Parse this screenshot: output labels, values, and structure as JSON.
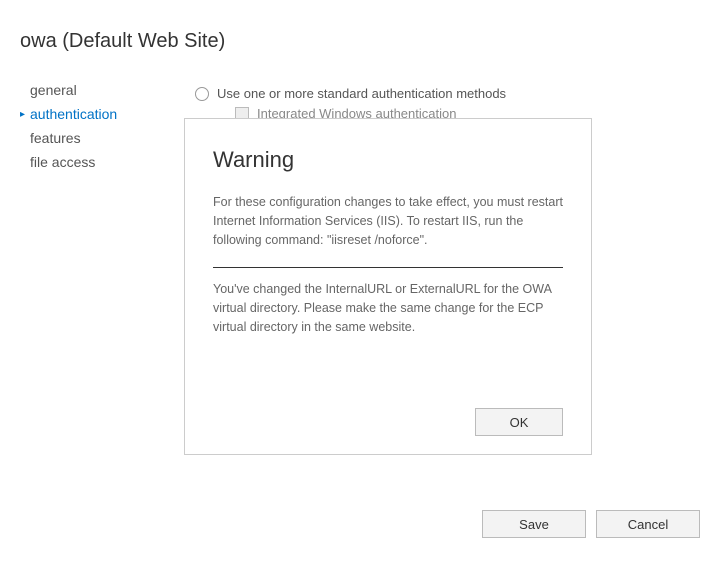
{
  "title": "owa (Default Web Site)",
  "sidebar": {
    "items": [
      {
        "label": "general"
      },
      {
        "label": "authentication"
      },
      {
        "label": "features"
      },
      {
        "label": "file access"
      }
    ]
  },
  "main": {
    "radio_label": "Use one or more standard authentication methods",
    "checkbox_label": "Integrated Windows authentication"
  },
  "dialog": {
    "title": "Warning",
    "para1": "For these configuration changes to take effect, you must restart Internet Information Services (IIS). To restart IIS, run the following command: \"iisreset /noforce\".",
    "para2": "You've changed the InternalURL or ExternalURL for the OWA virtual directory. Please make the same change for the ECP virtual directory in the same website.",
    "ok_label": "OK"
  },
  "footer": {
    "save_label": "Save",
    "cancel_label": "Cancel"
  }
}
